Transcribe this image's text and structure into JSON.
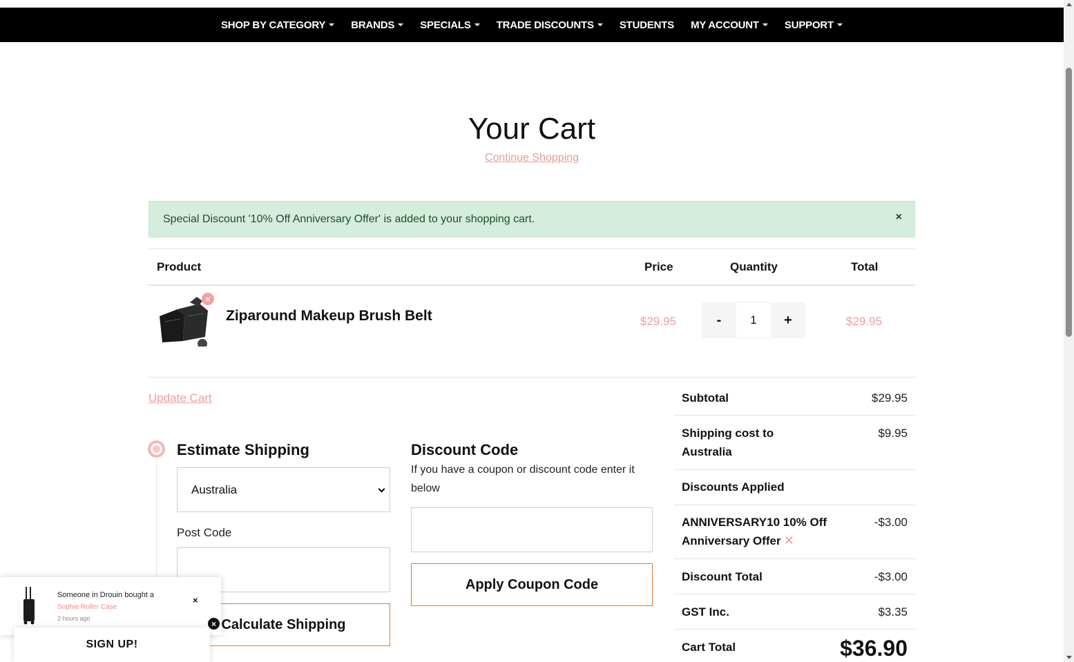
{
  "nav": {
    "items": [
      {
        "label": "SHOP BY CATEGORY",
        "dropdown": true
      },
      {
        "label": "BRANDS",
        "dropdown": true
      },
      {
        "label": "SPECIALS",
        "dropdown": true
      },
      {
        "label": "TRADE DISCOUNTS",
        "dropdown": true
      },
      {
        "label": "STUDENTS",
        "dropdown": false
      },
      {
        "label": "MY ACCOUNT",
        "dropdown": true
      },
      {
        "label": "SUPPORT",
        "dropdown": true
      }
    ]
  },
  "page": {
    "title": "Your Cart",
    "continue_link": "Continue Shopping"
  },
  "alert": {
    "message": "Special Discount '10% Off Anniversary Offer' is added to your shopping cart.",
    "close": "×"
  },
  "table": {
    "headers": {
      "product": "Product",
      "price": "Price",
      "quantity": "Quantity",
      "total": "Total"
    },
    "items": [
      {
        "name": "Ziparound Makeup Brush Belt",
        "price": "$29.95",
        "quantity": "1",
        "total": "$29.95",
        "remove": "×"
      }
    ],
    "minus": "-",
    "plus": "+"
  },
  "update_cart": "Update Cart",
  "shipping": {
    "title": "Estimate Shipping",
    "country": "Australia",
    "postcode_label": "Post Code",
    "postcode_value": "",
    "button": "Calculate Shipping"
  },
  "discount": {
    "title": "Discount Code",
    "help": "If you have a coupon or discount code enter it below",
    "value": "",
    "button": "Apply Coupon Code"
  },
  "summary": {
    "subtotal_label": "Subtotal",
    "subtotal": "$29.95",
    "shipping_label": "Shipping cost to Australia",
    "shipping": "$9.95",
    "discounts_label": "Discounts Applied",
    "coupon_label": "ANNIVERSARY10 10% Off Anniversary Offer",
    "coupon_value": "-$3.00",
    "discount_total_label": "Discount Total",
    "discount_total": "-$3.00",
    "gst_label": "GST Inc.",
    "gst": "$3.35",
    "cart_total_label": "Cart Total",
    "cart_total": "$36.90"
  },
  "toast": {
    "text": "Someone in Drouin bought a",
    "product": "Sophie Roller Case",
    "time": "2 hours ago",
    "close": "×"
  },
  "signup": {
    "label": "SIGN UP!",
    "close": "×"
  },
  "colors": {
    "accent_pink": "#ef9d9d",
    "button_border": "#e07a2a",
    "alert_bg": "#d4eddc",
    "nav_bg": "#000000"
  }
}
